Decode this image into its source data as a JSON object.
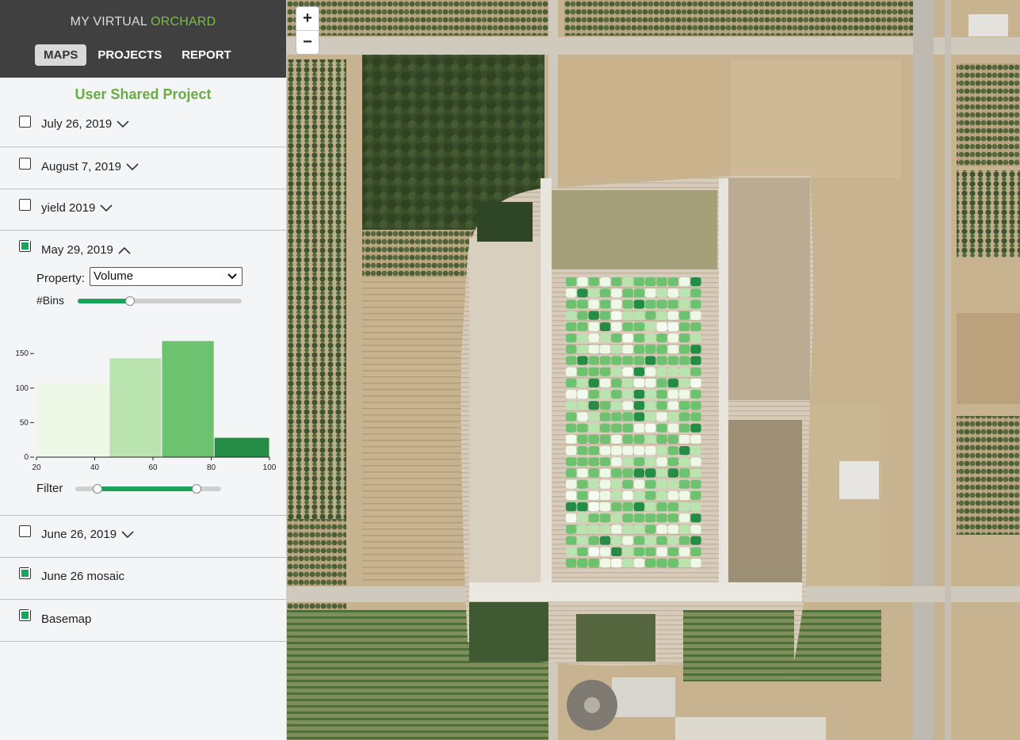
{
  "header": {
    "title_part1": "MY VIRTUAL ",
    "title_part2": "ORCHARD",
    "nav": [
      "MAPS",
      "PROJECTS",
      "REPORT"
    ]
  },
  "project": {
    "title": "User Shared Project"
  },
  "layers": [
    {
      "label": "July 26, 2019",
      "checked": false,
      "expander": "chevron-down"
    },
    {
      "label": "August 7, 2019",
      "checked": false,
      "expander": "chevron-down"
    },
    {
      "label": "yield 2019",
      "checked": false,
      "expander": "chevron-down"
    },
    {
      "label": "May 29, 2019",
      "checked": true,
      "expander": "chevron-up"
    },
    {
      "label": "June 26, 2019",
      "checked": false,
      "expander": "chevron-down"
    },
    {
      "label": "June 26 mosaic",
      "checked": true
    },
    {
      "label": "Basemap",
      "checked": true
    }
  ],
  "controls": {
    "property_label": "Property:",
    "property_value": "Volume",
    "bins_label": "#Bins",
    "bins_fraction": 0.32,
    "filter_label": "Filter",
    "filter_range_fraction": [
      0.15,
      0.83
    ]
  },
  "chart_data": {
    "type": "bar",
    "bins": [
      [
        20,
        45
      ],
      [
        45,
        63
      ],
      [
        63,
        81
      ],
      [
        81,
        100
      ]
    ],
    "values": [
      107,
      143,
      168,
      28
    ],
    "colors": [
      "#edf8e7",
      "#b9e4b0",
      "#6cc26e",
      "#238c45"
    ],
    "xticks": [
      "20",
      "40",
      "60",
      "80",
      "100"
    ],
    "yticks": [
      "0",
      "50",
      "100",
      "150"
    ],
    "xlim": [
      20,
      100
    ],
    "ylim": [
      0,
      180
    ]
  },
  "map": {
    "zoom_in": "+",
    "zoom_out": "−"
  }
}
